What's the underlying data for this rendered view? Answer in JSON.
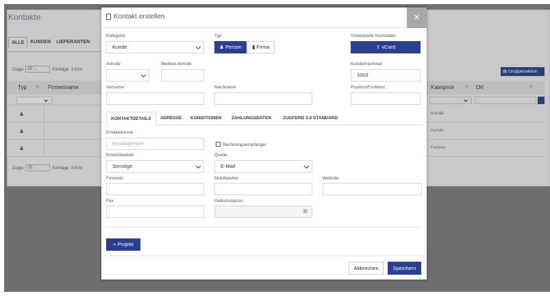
{
  "background": {
    "title": "Kontakte",
    "tabs": [
      "ALLE",
      "KUNDEN",
      "LIEFERANTEN"
    ],
    "show_label": "Zeige",
    "show_value": "25",
    "entries_label": "Einträge",
    "entries_count": "3 Eint",
    "columns": {
      "typ": "Typ",
      "firmenname": "Firmenname",
      "kategorie": "Kategorie",
      "ort": "Ort"
    },
    "group_action": "Gruppenaktion",
    "rows": [
      {
        "kategorie": "Kunde"
      },
      {
        "kategorie": "Kunde"
      },
      {
        "kategorie": "Partner"
      }
    ]
  },
  "modal": {
    "title": "Kontakt erstellen",
    "close": "×",
    "kategorie": {
      "label": "Kategorie",
      "value": "Kunde"
    },
    "typ": {
      "label": "Typ",
      "person": "Person",
      "firma": "Firma"
    },
    "vcard": {
      "label": "Visitenkarte hochladen",
      "button": "vCard"
    },
    "anrede": {
      "label": "Anrede",
      "value": ""
    },
    "weitere_anrede": {
      "label": "Weitere Anrede",
      "value": ""
    },
    "kundennummer": {
      "label": "Kundennummer",
      "value": "1003"
    },
    "vorname": {
      "label": "Vorname",
      "value": ""
    },
    "nachname": {
      "label": "Nachname",
      "value": ""
    },
    "position": {
      "label": "Position/Funktion",
      "value": ""
    },
    "tabs": [
      "KONTAKTDETAILS",
      "ADRESSE",
      "KONDITIONEN",
      "ZAHLUNGSDATEN",
      "ZUGFERD 2.0 STANDARD"
    ],
    "email": {
      "label": "Emailadresse",
      "placeholder": "Emailadresse"
    },
    "rechnungsempfaenger": "Rechnungsempfänger",
    "erreichbarkeit": {
      "label": "Erreichbarkeit",
      "value": "Sonstige"
    },
    "quelle": {
      "label": "Quelle",
      "value": "E-Mail"
    },
    "festnetz": {
      "label": "Festnetz",
      "value": ""
    },
    "mobiltelefon": {
      "label": "Mobiltelefon",
      "value": ""
    },
    "website": {
      "label": "Website",
      "value": ""
    },
    "fax": {
      "label": "Fax",
      "value": ""
    },
    "geburtsdatum": {
      "label": "Geburtsdatum",
      "value": ""
    },
    "projekt_button": "Projekt",
    "abbrechen": "Abbrechen",
    "speichern": "Speichern"
  },
  "colors": {
    "navy": "#2c3e8f",
    "overlay": "#6e6e6e",
    "close_bg": "#a8a8a8"
  }
}
